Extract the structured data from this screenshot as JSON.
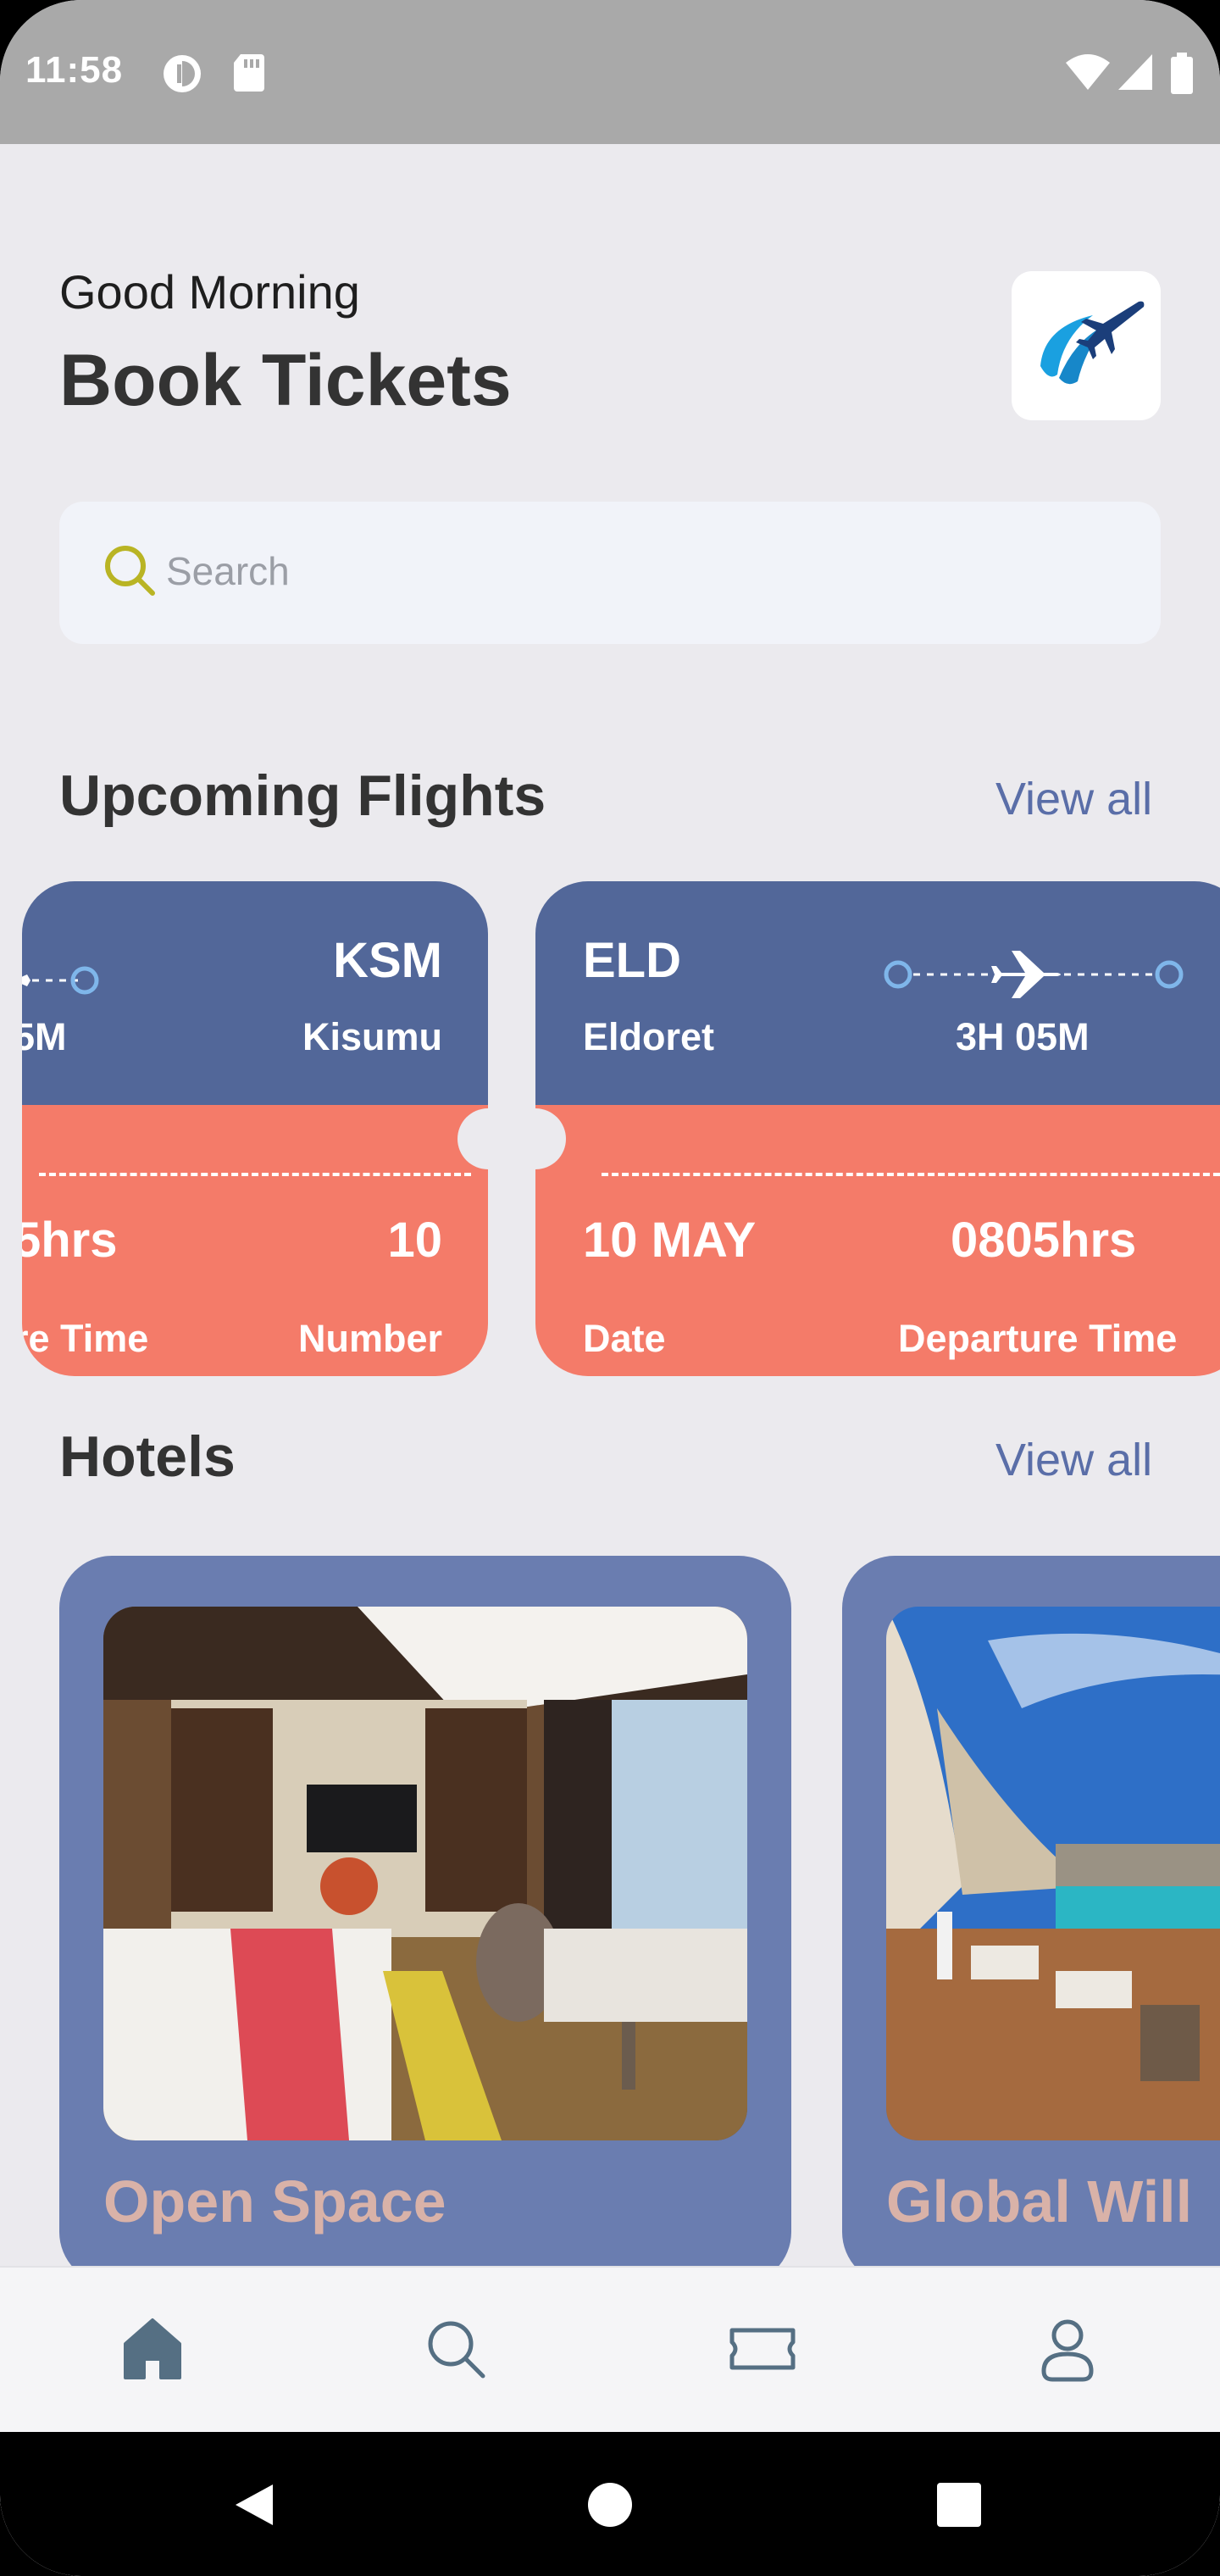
{
  "status_bar": {
    "time": "11:58"
  },
  "header": {
    "greeting": "Good Morning",
    "title": "Book Tickets"
  },
  "search": {
    "placeholder": "Search"
  },
  "upcoming_flights": {
    "title": "Upcoming Flights",
    "view_all": "View all",
    "cards": [
      {
        "dest_code": "KSM",
        "dest_name": "Kisumu",
        "duration_partial": "5M",
        "time_partial": "5hrs",
        "time_label_partial": "re Time",
        "number": "10",
        "number_label": "Number"
      },
      {
        "origin_code": "ELD",
        "origin_name": "Eldoret",
        "duration": "3H 05M",
        "date": "10 MAY",
        "date_label": "Date",
        "departure_time": "0805hrs",
        "departure_label": "Departure Time"
      }
    ]
  },
  "hotels": {
    "title": "Hotels",
    "view_all": "View all",
    "items": [
      {
        "name": "Open Space"
      },
      {
        "name": "Global Will"
      }
    ]
  },
  "bottom_nav": {
    "items": [
      "home-icon",
      "search-icon",
      "ticket-icon",
      "profile-icon"
    ]
  },
  "colors": {
    "ticket_top": "#526799",
    "ticket_bottom": "#f47b69",
    "hotel_card": "#6a7db0",
    "accent": "#5a6ea8"
  }
}
